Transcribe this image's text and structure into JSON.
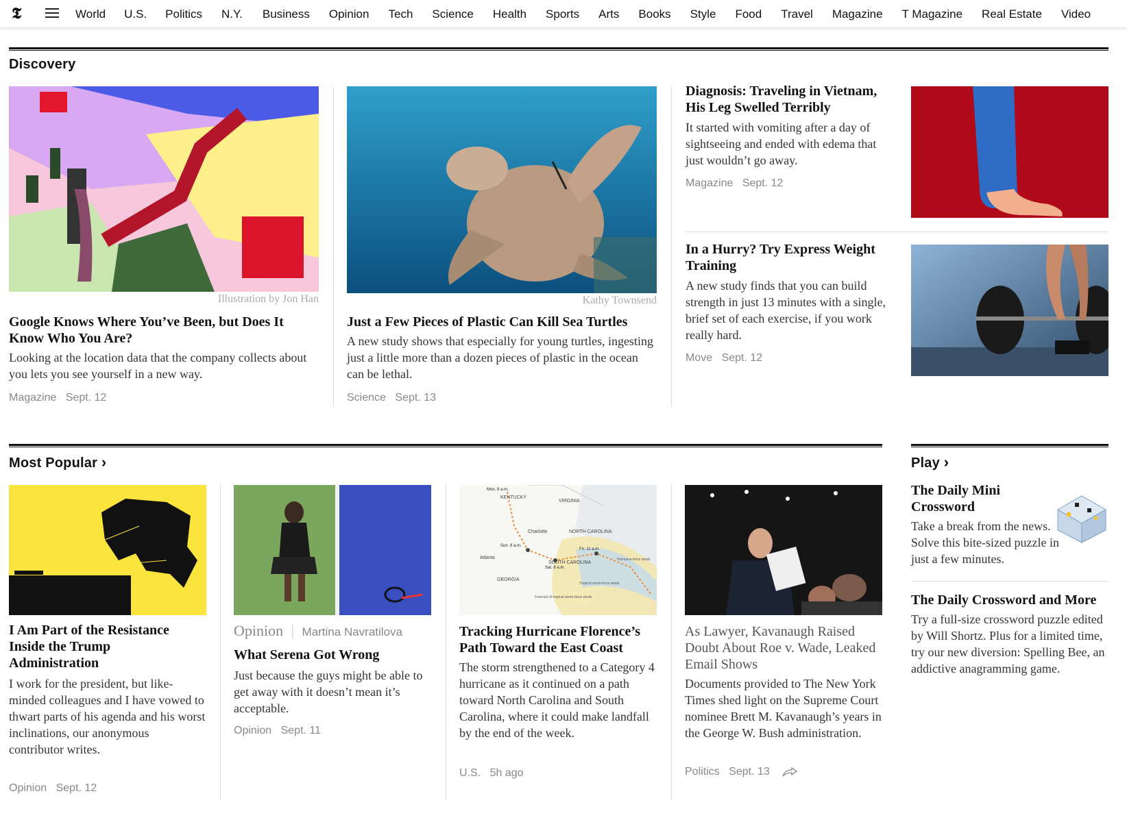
{
  "nav": {
    "logo": "𝕿",
    "items": [
      "World",
      "U.S.",
      "Politics",
      "N.Y.",
      "Business",
      "Opinion",
      "Tech",
      "Science",
      "Health",
      "Sports",
      "Arts",
      "Books",
      "Style",
      "Food",
      "Travel",
      "Magazine",
      "T Magazine",
      "Real Estate",
      "Video"
    ]
  },
  "discovery": {
    "title": "Discovery",
    "google": {
      "credit": "Illustration by Jon Han",
      "headline": "Google Knows Where You’ve Been, but Does It Know Who You Are?",
      "summary": "Looking at the location data that the company collects about you lets you see yourself in a new way.",
      "section": "Magazine",
      "date": "Sept. 12"
    },
    "turtles": {
      "credit": "Kathy Townsend",
      "headline": "Just a Few Pieces of Plastic Can Kill Sea Turtles",
      "summary": "A new study shows that especially for young turtles, ingesting just a little more than a dozen pieces of plastic in the ocean can be lethal.",
      "section": "Science",
      "date": "Sept. 13"
    },
    "diagnosis": {
      "headline": "Diagnosis: Traveling in Vietnam, His Leg Swelled Terribly",
      "summary": "It started with vomiting after a day of sightseeing and ended with edema that just wouldn’t go away.",
      "section": "Magazine",
      "date": "Sept. 12"
    },
    "weights": {
      "headline": "In a Hurry? Try Express Weight Training",
      "summary": "A new study finds that you can build strength in just 13 minutes with a single, brief set of each exercise, if you work really hard.",
      "section": "Move",
      "date": "Sept. 12"
    }
  },
  "popular": {
    "title": "Most Popular",
    "chevron": "›",
    "resistance": {
      "headline": "I Am Part of the Resistance Inside the Trump Administration",
      "summary": "I work for the president, but like-minded colleagues and I have vowed to thwart parts of his agenda and his worst inclinations, our anonymous contributor writes.",
      "section": "Opinion",
      "date": "Sept. 12"
    },
    "serena": {
      "kicker": "Opinion",
      "author": "Martina Navratilova",
      "headline": "What Serena Got Wrong",
      "summary": "Just because the guys might be able to get away with it doesn’t mean it’s acceptable.",
      "section": "Opinion",
      "date": "Sept. 11"
    },
    "hurricane": {
      "headline": "Tracking Hurricane Florence’s Path Toward the East Coast",
      "summary": "The storm strengthened to a Category 4 hurricane as it continued on a path toward North Carolina and South Carolina, where it could make landfall by the end of the week.",
      "section": "U.S.",
      "date": "5h ago",
      "map_labels": [
        "KENTUCKY",
        "VIRGINIA",
        "NORTH CAROLINA",
        "SOUTH CAROLINA",
        "GEORGIA",
        "Atlanta",
        "Charlotte",
        "Mon. 8 a.m.",
        "Sun. 8 a.m.",
        "Sat. 8 a.m.",
        "Fri. 11 a.m.",
        "Hurricane-force winds",
        "Tropical storm-force winds",
        "Forecast of tropical storm-force winds"
      ]
    },
    "kavanaugh": {
      "headline": "As Lawyer, Kavanaugh Raised Doubt About Roe v. Wade, Leaked Email Shows",
      "summary": "Documents provided to The New York Times shed light on the Supreme Court nominee Brett M. Kavanaugh’s years in the George W. Bush administration.",
      "section": "Politics",
      "date": "Sept. 13"
    }
  },
  "play": {
    "title": "Play",
    "chevron": "›",
    "mini": {
      "headline": "The Daily Mini Crossword",
      "summary": "Take a break from the news. Solve this bite-sized puzzle in just a few minutes."
    },
    "crossword": {
      "headline": "The Daily Crossword and More",
      "summary": "Try a full-size crossword puzzle edited by Will Shortz. Plus for a limited time, try our new diversion: Spelling Bee, an addictive anagramming game."
    }
  }
}
